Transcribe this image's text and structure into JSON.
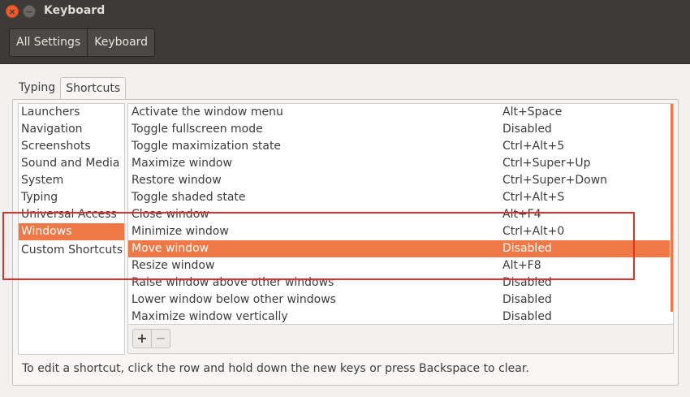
{
  "window": {
    "title": "Keyboard",
    "close_glyph": "×",
    "minimize_glyph": "−"
  },
  "nav": {
    "all_settings": "All Settings",
    "current": "Keyboard"
  },
  "tabs": [
    {
      "label": "Typing"
    },
    {
      "label": "Shortcuts"
    }
  ],
  "categories": [
    {
      "label": "Launchers"
    },
    {
      "label": "Navigation"
    },
    {
      "label": "Screenshots"
    },
    {
      "label": "Sound and Media"
    },
    {
      "label": "System"
    },
    {
      "label": "Typing"
    },
    {
      "label": "Universal Access"
    },
    {
      "label": "Windows"
    },
    {
      "label": "Custom Shortcuts"
    }
  ],
  "shortcuts": [
    {
      "name": "Activate the window menu",
      "key": "Alt+Space"
    },
    {
      "name": "Toggle fullscreen mode",
      "key": "Disabled"
    },
    {
      "name": "Toggle maximization state",
      "key": "Ctrl+Alt+5"
    },
    {
      "name": "Maximize window",
      "key": "Ctrl+Super+Up"
    },
    {
      "name": "Restore window",
      "key": "Ctrl+Super+Down"
    },
    {
      "name": "Toggle shaded state",
      "key": "Ctrl+Alt+S"
    },
    {
      "name": "Close window",
      "key": "Alt+F4"
    },
    {
      "name": "Minimize window",
      "key": "Ctrl+Alt+0"
    },
    {
      "name": "Move window",
      "key": "Disabled"
    },
    {
      "name": "Resize window",
      "key": "Alt+F8"
    },
    {
      "name": "Raise window above other windows",
      "key": "Disabled"
    },
    {
      "name": "Lower window below other windows",
      "key": "Disabled"
    },
    {
      "name": "Maximize window vertically",
      "key": "Disabled"
    }
  ],
  "toolbar": {
    "add": "+",
    "remove": "−"
  },
  "hint": "To edit a shortcut, click the row and hold down the new keys or press Backspace to clear.",
  "colors": {
    "accent": "#f07746",
    "titlebar": "#3c3b37",
    "annotation": "#e0302c"
  }
}
